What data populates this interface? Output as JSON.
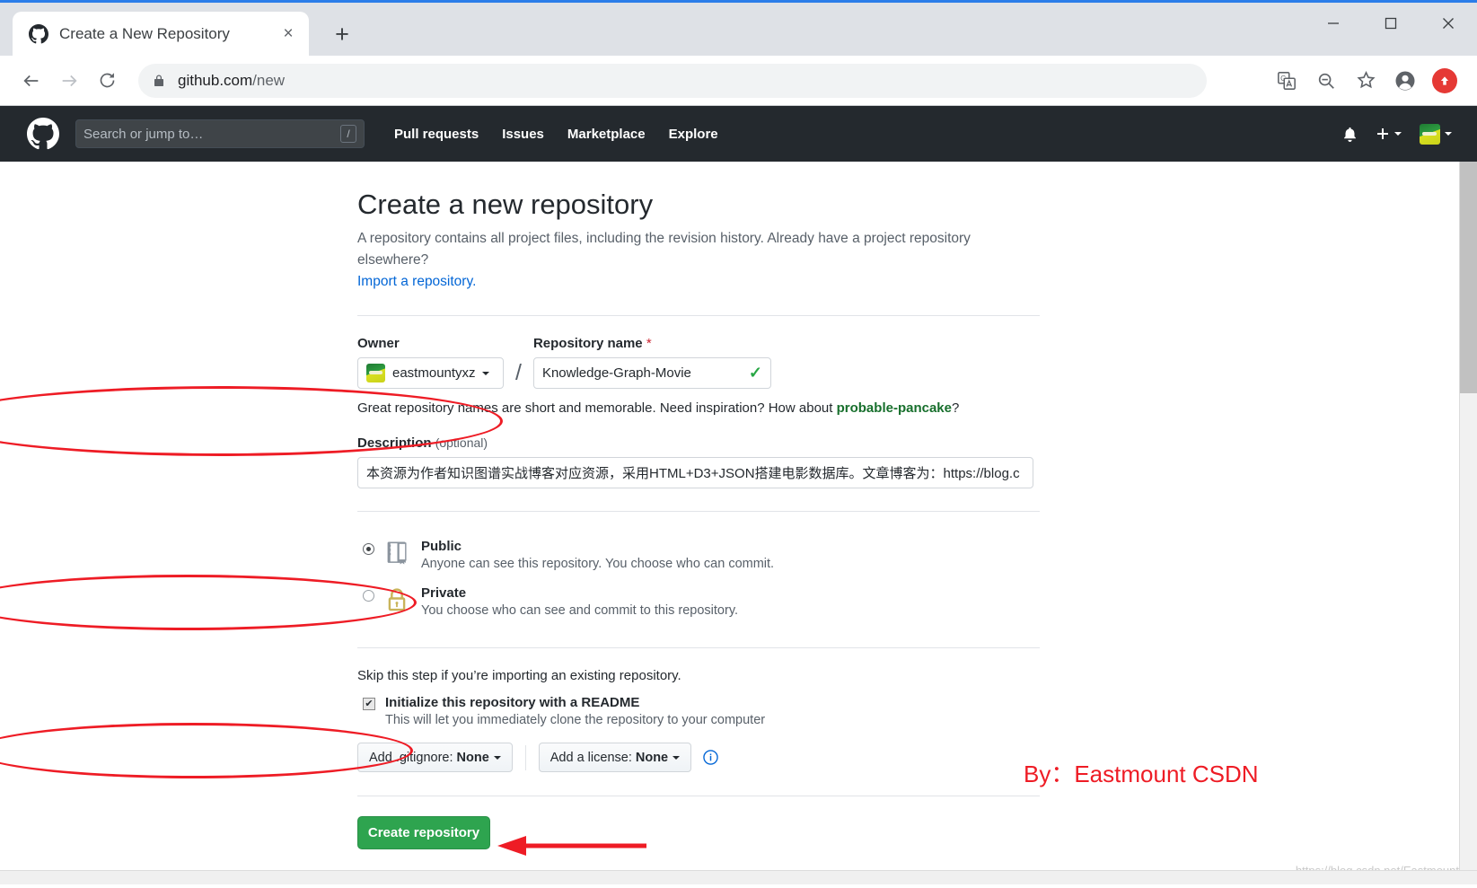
{
  "browser": {
    "tab": {
      "title": "Create a New Repository",
      "favicon": "github-icon",
      "close": "×"
    },
    "new_tab": "+",
    "window_controls": {
      "minimize": "−",
      "maximize": "□",
      "close": "✕"
    },
    "nav": {
      "back": "back-arrow-icon",
      "forward": "forward-arrow-icon",
      "reload": "reload-icon"
    },
    "address": {
      "lock": "lock-icon",
      "url_host": "github.com",
      "url_path": "/new"
    },
    "toolbar_icons": [
      "translate-icon",
      "zoom-out-icon",
      "bookmark-star-icon",
      "profile-icon",
      "update-icon"
    ]
  },
  "github_header": {
    "logo": "github-mark-icon",
    "search_placeholder": "Search or jump to…",
    "search_shortcut": "/",
    "nav_items": [
      "Pull requests",
      "Issues",
      "Marketplace",
      "Explore"
    ],
    "notifications": "bell-icon",
    "plus_menu": "plus-icon",
    "avatar": "user-avatar"
  },
  "main": {
    "title": "Create a new repository",
    "lede_text": "A repository contains all project files, including the revision history. Already have a project repository elsewhere?",
    "import_link": "Import a repository.",
    "owner": {
      "label": "Owner",
      "value": "eastmountyxz"
    },
    "separator": "/",
    "repo_name": {
      "label": "Repository name",
      "required_mark": "*",
      "value": "Knowledge-Graph-Movie",
      "valid_mark": "✓"
    },
    "name_hint_prefix": "Great repository names are short and memorable. Need inspiration? How about ",
    "name_hint_suggestion": "probable-pancake",
    "name_hint_suffix": "?",
    "description": {
      "label": "Description",
      "optional": "(optional)",
      "value": "本资源为作者知识图谱实战博客对应资源，采用HTML+D3+JSON搭建电影数据库。文章博客为：https://blog.c"
    },
    "visibility": [
      {
        "id": "public",
        "title": "Public",
        "desc": "Anyone can see this repository. You choose who can commit.",
        "selected": true,
        "icon": "repo-book-icon"
      },
      {
        "id": "private",
        "title": "Private",
        "desc": "You choose who can see and commit to this repository.",
        "selected": false,
        "icon": "lock-icon"
      }
    ],
    "skip_note": "Skip this step if you’re importing an existing repository.",
    "readme": {
      "title": "Initialize this repository with a README",
      "desc": "This will let you immediately clone the repository to your computer",
      "checked": true,
      "check_glyph": "✔"
    },
    "gitignore_button": {
      "prefix": "Add .gitignore:",
      "value": "None",
      "caret": "▾"
    },
    "license_button": {
      "prefix": "Add a license:",
      "value": "None",
      "caret": "▾"
    },
    "info_icon": "info-circle-icon",
    "create_button": "Create repository"
  },
  "annotations": {
    "byline": "By：Eastmount CSDN",
    "watermark": "https://blog.csdn.net/Eastmount",
    "accent_red": "#ee1c25",
    "github_green": "#2ea44f"
  }
}
